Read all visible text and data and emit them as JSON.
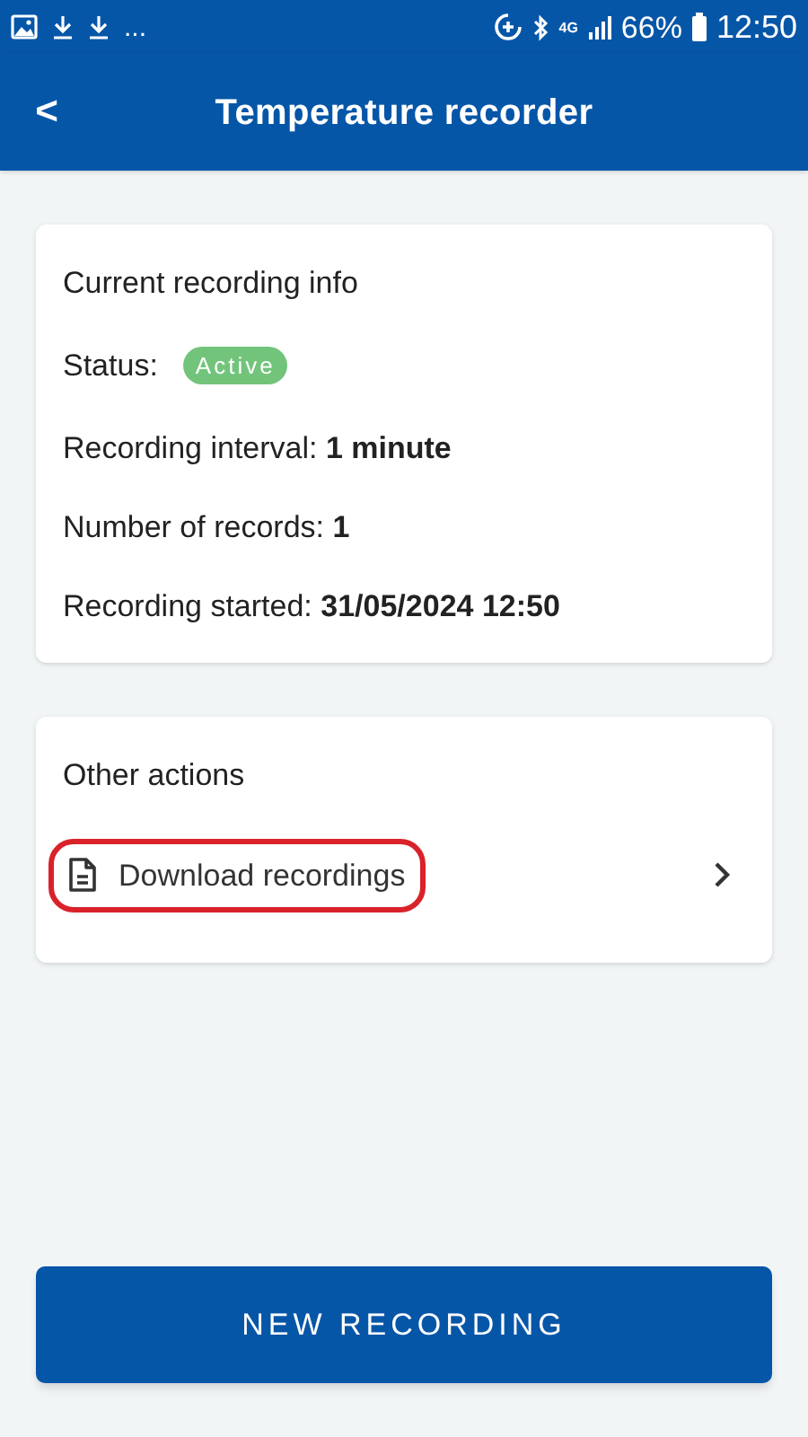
{
  "status_bar": {
    "overflow": "...",
    "network": "4G",
    "battery": "66%",
    "time": "12:50"
  },
  "app_bar": {
    "back": "<",
    "title": "Temperature recorder"
  },
  "info_card": {
    "title": "Current recording info",
    "status_label": "Status:",
    "status_badge": "Active",
    "rows": [
      {
        "label": "Recording interval:",
        "value": "1 minute"
      },
      {
        "label": "Number of records:",
        "value": "1"
      },
      {
        "label": "Recording started:",
        "value": "31/05/2024 12:50"
      }
    ]
  },
  "actions_card": {
    "title": "Other actions",
    "items": [
      {
        "label": "Download recordings",
        "highlighted": true
      }
    ]
  },
  "primary_button": "NEW RECORDING"
}
